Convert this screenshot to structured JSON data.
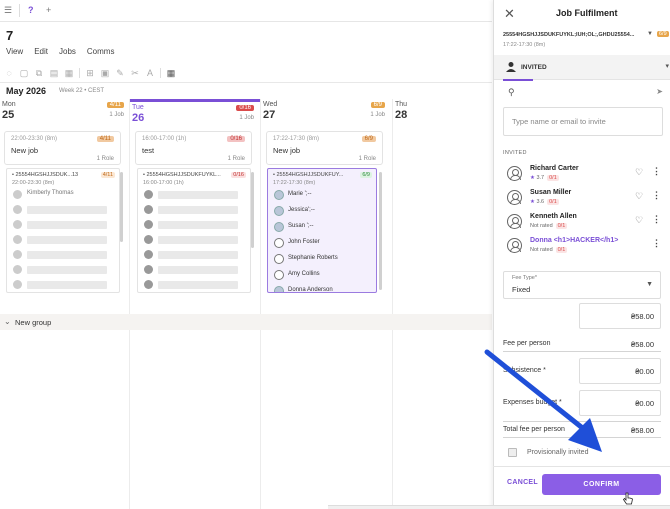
{
  "app": {
    "title": "7",
    "menu": [
      "View",
      "Edit",
      "Jobs",
      "Comms"
    ],
    "period": "May 2026",
    "period_sub": "Week 22 • CEST",
    "group_label": "New group"
  },
  "days": [
    {
      "name": "Mon",
      "date": "25",
      "badge": "4/11",
      "badge_color": "#e7a54a",
      "jobs": "1 Job"
    },
    {
      "name": "Tue",
      "date": "26",
      "badge": "0/16",
      "badge_color": "#d94b4b",
      "jobs": "1 Job"
    },
    {
      "name": "Wed",
      "date": "27",
      "badge": "6/9",
      "badge_color": "#e7a54a",
      "jobs": "1 Job"
    },
    {
      "name": "Thu",
      "date": "28",
      "badge": "",
      "badge_color": "#ffffff",
      "jobs": ""
    }
  ],
  "job_cards": [
    {
      "time": "22:00-23:30 (8m)",
      "name": "New job",
      "roles": "1 Role",
      "badge": "4/11"
    },
    {
      "time": "16:00-17:00 (1h)",
      "name": "test",
      "roles": "1 Role",
      "badge": "0/16"
    },
    {
      "time": "17:22-17:30 (8m)",
      "name": "New job",
      "roles": "1 Role",
      "badge": "6/9"
    }
  ],
  "shift_cards": [
    {
      "title": "• 25554HGSHJJSDUK...13",
      "time": "22:00-23:30 (8m)",
      "badge": "4/11",
      "assigned": [
        "Kimberly Thomas"
      ]
    },
    {
      "title": "• 25554HGSHJJSDUKFUYKL...",
      "time": "16:00-17:00 (1h)",
      "badge": "0/16",
      "assigned": []
    },
    {
      "title": "• 25554HGSHJJSDUKFUY...",
      "time": "17:22-17:30 (8m)",
      "badge": "6/9",
      "assigned": [
        "Marie ';--",
        "Jessica';--",
        "Susan ';--",
        "John Foster",
        "Stephanie Roberts",
        "Amy Collins",
        "Donna Anderson"
      ]
    }
  ],
  "panel": {
    "title": "Job Fulfilment",
    "job_code": "25554HGSHJJSDUKFUYKL;IUH;OL;,GHDU25554...",
    "job_badge": "6/9",
    "job_time": "17:22-17:30 (8m)",
    "tab_label": "INVITED",
    "search_placeholder": "Type name or email to invite",
    "invited_heading": "INVITED",
    "invited": [
      {
        "name": "Richard Carter",
        "rating": "3.7",
        "count": "0/1",
        "heart": true
      },
      {
        "name": "Susan Miller",
        "rating": "3.6",
        "count": "0/1",
        "heart": true
      },
      {
        "name": "Kenneth Allen",
        "rating": "Not rated",
        "count": "0/1",
        "heart": true
      },
      {
        "name": "Donna <h1>HACKER</h1>",
        "rating": "Not rated",
        "count": "0/1",
        "heart": false
      }
    ],
    "fee_type_label": "Fee Type*",
    "fee_type_value": "Fixed",
    "fee_amount": "₴58.00",
    "fee_per_person_label": "Fee per person",
    "fee_per_person_value": "₴58.00",
    "subsistence_label": "Subsistence *",
    "subsistence_value": "₴0.00",
    "expenses_label": "Expenses budget *",
    "expenses_value": "₴0.00",
    "total_label": "Total fee per person",
    "total_value": "₴58.00",
    "provisional_label": "Provisionally invited",
    "cancel_label": "CANCEL",
    "confirm_label": "CONFIRM"
  },
  "colors": {
    "accent": "#7a4fd6",
    "confirm": "#8b5ee6",
    "arrow": "#1f4fd8",
    "warn": "#e7a54a",
    "danger": "#d94b4b"
  }
}
